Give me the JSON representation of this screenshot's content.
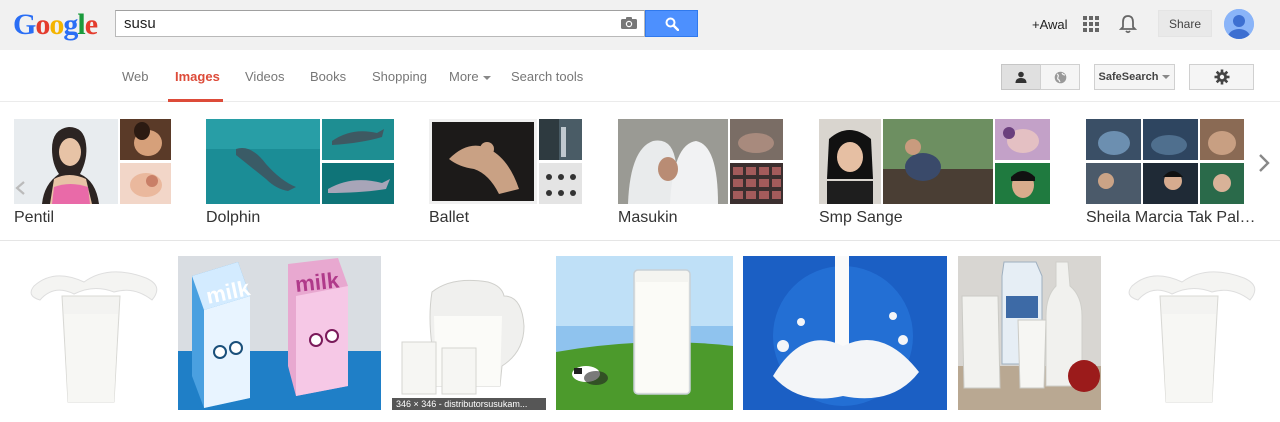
{
  "header": {
    "logo_letters": [
      "G",
      "o",
      "o",
      "g",
      "l",
      "e"
    ],
    "logo_colors": [
      "#2a6ef5",
      "#e43c2d",
      "#f4b400",
      "#2a6ef5",
      "#1a9a3c",
      "#e43c2d"
    ],
    "search_value": "susu",
    "plus_name": "+Awal",
    "share_label": "Share"
  },
  "nav": {
    "items": [
      "Web",
      "Images",
      "Videos",
      "Books",
      "Shopping",
      "More",
      "Search tools"
    ],
    "active": "Images",
    "safesearch_label": "SafeSearch"
  },
  "related": [
    {
      "label": "Pentil"
    },
    {
      "label": "Dolphin"
    },
    {
      "label": "Ballet"
    },
    {
      "label": "Masukin"
    },
    {
      "label": "Smp Sange"
    },
    {
      "label": "Sheila Marcia Tak Pal…"
    }
  ],
  "results": [
    {
      "name": "milk-glass-splash"
    },
    {
      "name": "milk-cartoon-cartons"
    },
    {
      "name": "milk-jug-glasses",
      "caption": "346 × 346 - distributorsusukam..."
    },
    {
      "name": "milk-glass-cows"
    },
    {
      "name": "milk-splash-blue"
    },
    {
      "name": "milk-bottles-jug"
    },
    {
      "name": "milk-glass-splash-2"
    }
  ],
  "colors": {
    "accent_red": "#dd4b39",
    "search_blue": "#4d90fe"
  }
}
